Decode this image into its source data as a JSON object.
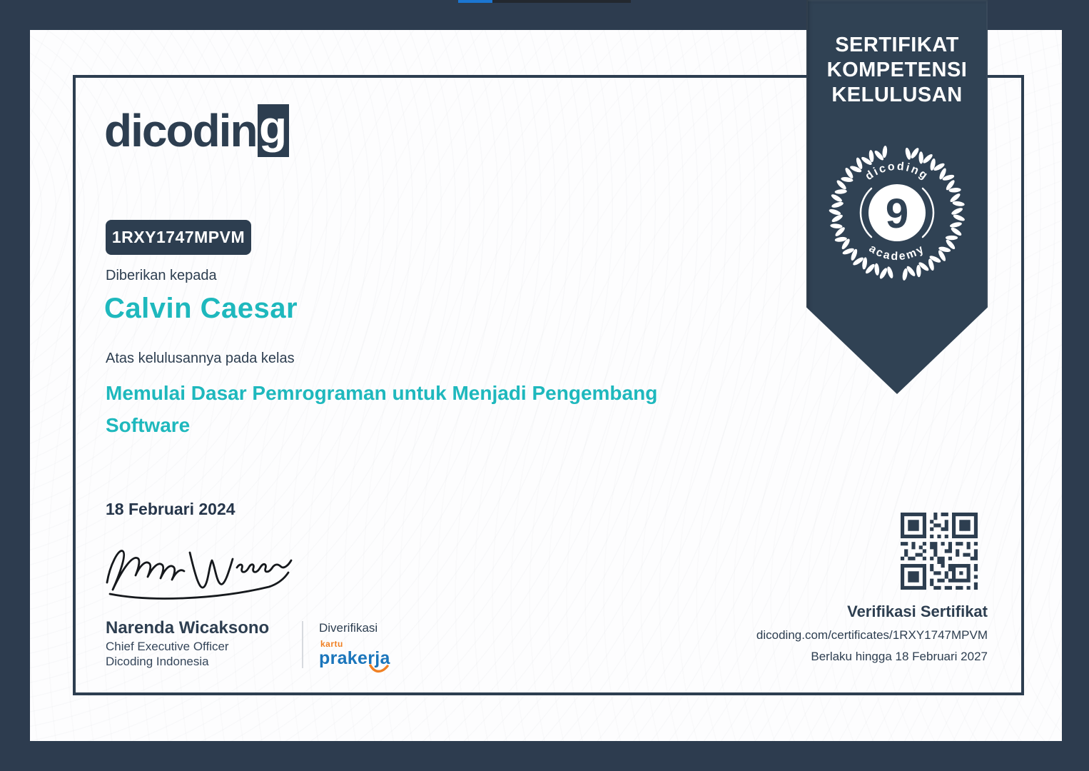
{
  "logo": {
    "prefix": "dicodin",
    "suffix": "g"
  },
  "id_badge": {
    "code": "1RXY1747MPVM"
  },
  "recipient": {
    "label": "Diberikan kepada",
    "name": "Calvin Caesar"
  },
  "course": {
    "label": "Atas kelulusannya pada kelas",
    "title": "Memulai Dasar Pemrograman untuk Menjadi Pengembang Software"
  },
  "issue_date": "18 Februari 2024",
  "signer": {
    "name": "Narenda Wicaksono",
    "title": "Chief Executive Officer",
    "org": "Dicoding Indonesia"
  },
  "verified": {
    "label": "Diverifikasi",
    "partner_top": "kartu",
    "partner_name": "prakerja"
  },
  "ribbon": {
    "lines": [
      "SERTIFIKAT",
      "KOMPETENSI",
      "KELULUSAN"
    ],
    "emblem": {
      "top": "dicoding",
      "number": "9",
      "bottom": "academy"
    }
  },
  "verification": {
    "heading": "Verifikasi Sertifikat",
    "url": "dicoding.com/certificates/1RXY1747MPVM",
    "valid_until": "Berlaku hingga 18 Februari 2027"
  },
  "colors": {
    "navy": "#2d3e50",
    "teal": "#1eb8bd",
    "orange": "#f08023",
    "partner_blue": "#1a75bb",
    "ribbon_navy": "#304254",
    "edge_blue": "#1b76d2"
  }
}
